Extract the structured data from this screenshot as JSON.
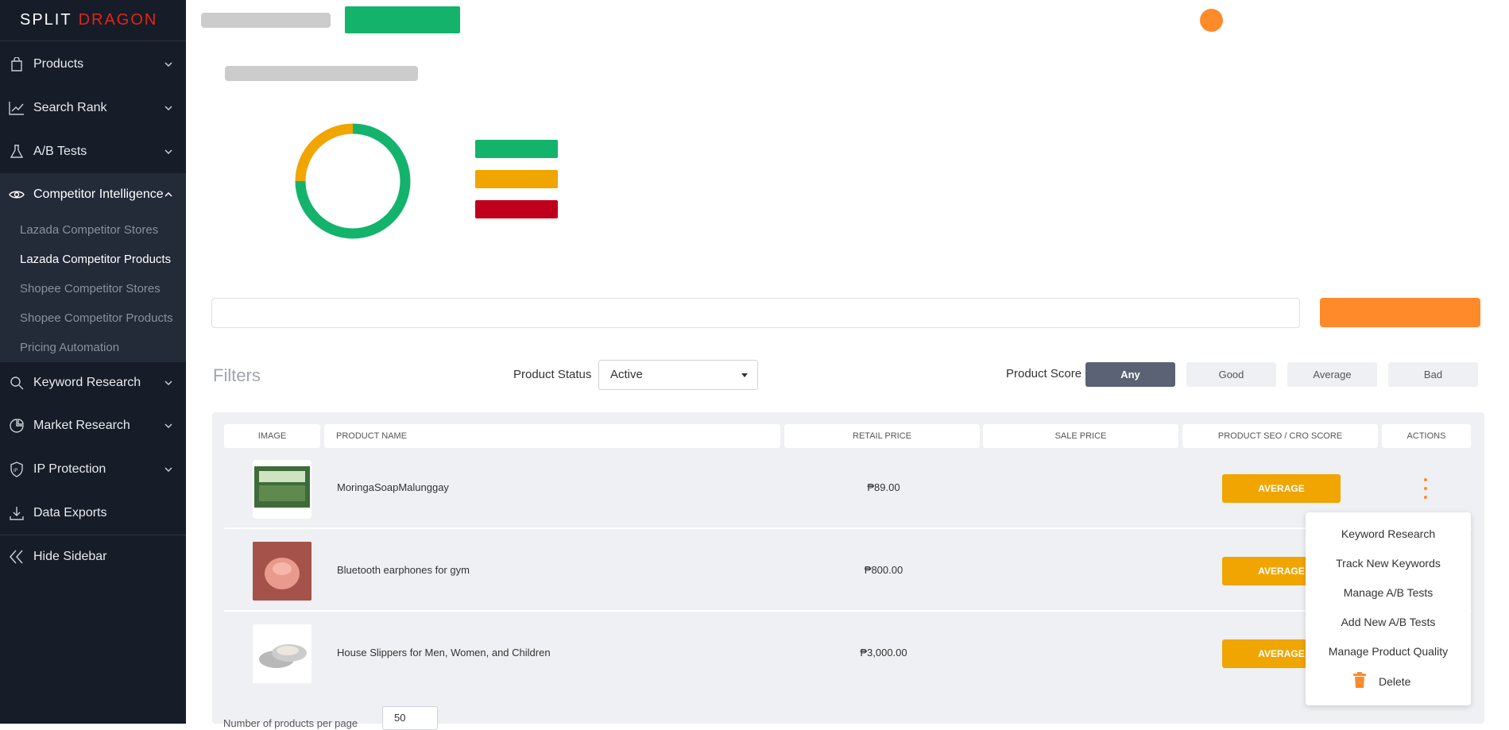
{
  "brand": {
    "word1": "SPLIT",
    "word2": "DRAGON"
  },
  "colors": {
    "sidebar": "#161c28",
    "accent": "#ff8a2a",
    "good": "#13b36c",
    "average": "#f0a500",
    "bad": "#c0001a"
  },
  "sidebar": {
    "items": [
      {
        "label": "Products",
        "icon": "bag-icon"
      },
      {
        "label": "Search Rank",
        "icon": "trend-icon"
      },
      {
        "label": "A/B Tests",
        "icon": "flask-icon"
      },
      {
        "label": "Competitor Intelligence",
        "icon": "eye-icon"
      },
      {
        "label": "Keyword Research",
        "icon": "search-icon"
      },
      {
        "label": "Market Research",
        "icon": "chart-icon"
      },
      {
        "label": "IP Protection",
        "icon": "shield-icon"
      },
      {
        "label": "Data Exports",
        "icon": "download-icon"
      },
      {
        "label": "Hide Sidebar",
        "icon": "double-chevron-left-icon"
      }
    ],
    "sub_items": [
      "Lazada Competitor Stores",
      "Lazada Competitor Products",
      "Shopee Competitor Stores",
      "Shopee Competitor Products",
      "Pricing Automation"
    ]
  },
  "donut": {
    "good_fraction": 0.75,
    "average_fraction": 0.25
  },
  "filters": {
    "title": "Filters",
    "status_label": "Product Status",
    "status_value": "Active",
    "score_label": "Product Score",
    "score_options": [
      "Any",
      "Good",
      "Average",
      "Bad"
    ],
    "score_selected": "Any"
  },
  "table": {
    "headers": [
      "IMAGE",
      "PRODUCT NAME",
      "RETAIL PRICE",
      "SALE PRICE",
      "PRODUCT SEO / CRO SCORE",
      "ACTIONS"
    ],
    "rows": [
      {
        "name": "MoringaSoapMalunggay",
        "retail": "₱89.00",
        "sale": "",
        "score": "AVERAGE"
      },
      {
        "name": "Bluetooth earphones for gym",
        "retail": "₱800.00",
        "sale": "",
        "score": "AVERAGE"
      },
      {
        "name": "House Slippers for Men, Women, and Children",
        "retail": "₱3,000.00",
        "sale": "",
        "score": "AVERAGE"
      }
    ]
  },
  "actions_menu": {
    "items": [
      "Keyword Research",
      "Track New Keywords",
      "Manage A/B Tests",
      "Add New A/B Tests",
      "Manage Product Quality"
    ],
    "delete": "Delete"
  },
  "footer": {
    "label": "Number of products per page",
    "per_page": "50"
  }
}
